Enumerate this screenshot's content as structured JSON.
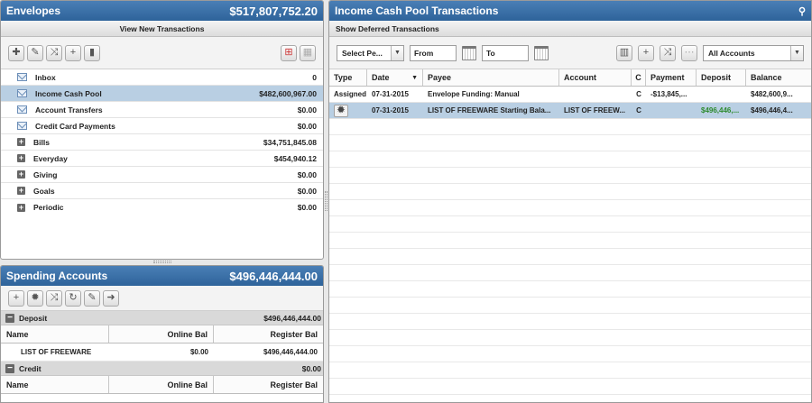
{
  "envelopes": {
    "title": "Envelopes",
    "total": "$517,807,752.20",
    "view_new": "View New Transactions",
    "toolbar_icons": [
      "add-envelope-icon",
      "tag-icon",
      "shuffle-icon",
      "plus-icon",
      "trash-icon"
    ],
    "toolbar_right_icons": [
      "fill-envelopes-icon",
      "grid-icon"
    ],
    "items": [
      {
        "icon": "inbox-icon",
        "name": "Inbox",
        "value": "0"
      },
      {
        "icon": "mail-icon",
        "name": "Income Cash Pool",
        "value": "$482,600,967.00",
        "selected": true
      },
      {
        "icon": "mail-icon",
        "name": "Account Transfers",
        "value": "$0.00"
      },
      {
        "icon": "mail-icon",
        "name": "Credit Card Payments",
        "value": "$0.00"
      },
      {
        "icon": "expand-icon",
        "name": "Bills",
        "value": "$34,751,845.08"
      },
      {
        "icon": "expand-icon",
        "name": "Everyday",
        "value": "$454,940.12"
      },
      {
        "icon": "expand-icon",
        "name": "Giving",
        "value": "$0.00"
      },
      {
        "icon": "expand-icon",
        "name": "Goals",
        "value": "$0.00"
      },
      {
        "icon": "expand-icon",
        "name": "Periodic",
        "value": "$0.00"
      }
    ]
  },
  "spending": {
    "title": "Spending Accounts",
    "total": "$496,446,444.00",
    "toolbar_icons": [
      "plus-icon",
      "gear-icon",
      "shuffle-icon",
      "refresh-icon",
      "edit-icon",
      "import-icon"
    ],
    "groups": [
      {
        "name": "Deposit",
        "total": "$496,446,444.00",
        "headers": {
          "name": "Name",
          "online": "Online Bal",
          "register": "Register Bal"
        },
        "rows": [
          {
            "name": "LIST OF FREEWARE",
            "online": "$0.00",
            "register": "$496,446,444.00"
          }
        ]
      },
      {
        "name": "Credit",
        "total": "$0.00",
        "headers": {
          "name": "Name",
          "online": "Online Bal",
          "register": "Register Bal"
        },
        "rows": []
      }
    ]
  },
  "income": {
    "title": "Income Cash Pool Transactions",
    "deferred": "Show Deferred Transactions",
    "period_select": "Select Pe...",
    "from_label": "From",
    "to_label": "To",
    "accounts_select": "All Accounts",
    "columns": {
      "type": "Type",
      "date": "Date",
      "date_sort": "▼",
      "payee": "Payee",
      "account": "Account",
      "c": "C",
      "payment": "Payment",
      "deposit": "Deposit",
      "balance": "Balance"
    },
    "rows": [
      {
        "type": "Assigned",
        "date": "07-31-2015",
        "payee": "Envelope Funding: Manual",
        "account": "",
        "c": "C",
        "payment": "-$13,845,...",
        "deposit": "",
        "balance": "$482,600,9..."
      },
      {
        "type": "",
        "date": "07-31-2015",
        "payee": "LIST OF FREEWARE Starting Bala...",
        "account": "LIST OF FREEW...",
        "c": "C",
        "payment": "",
        "deposit": "$496,446,...",
        "balance": "$496,446,4...",
        "selected": true
      }
    ]
  },
  "colors": {
    "title_bar": "#3a70a8",
    "selected_row": "#b9cfe3",
    "deposit_green": "#2d8a2d"
  }
}
